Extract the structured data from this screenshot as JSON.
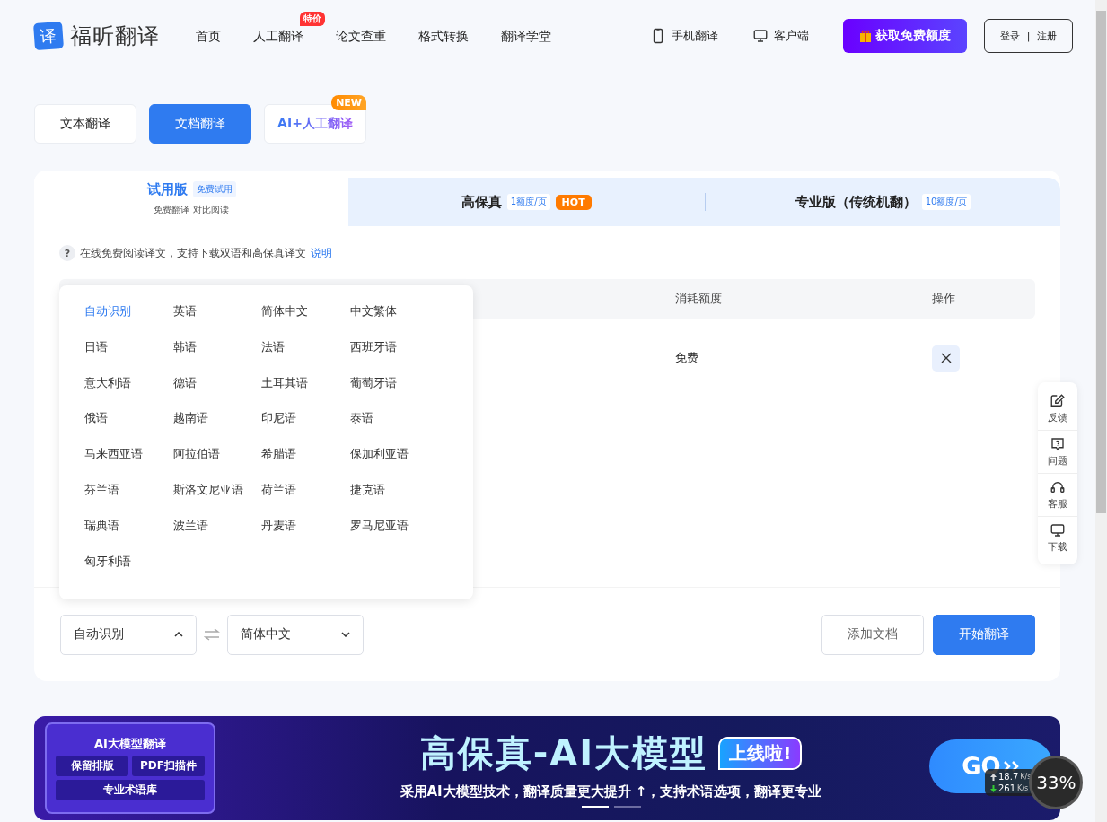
{
  "header": {
    "logo_mark": "译",
    "logo_text": "福昕翻译",
    "nav": [
      {
        "label": "首页"
      },
      {
        "label": "人工翻译",
        "badge": "特价"
      },
      {
        "label": "论文查重"
      },
      {
        "label": "格式转换"
      },
      {
        "label": "翻译学堂"
      }
    ],
    "links": [
      {
        "label": "手机翻译",
        "kind": "phone"
      },
      {
        "label": "客户端",
        "kind": "monitor"
      }
    ],
    "promo_button": "获取免费额度",
    "login": "登录",
    "separator": "|",
    "register": "注册"
  },
  "mode_tabs": [
    {
      "label": "文本翻译",
      "selected": false
    },
    {
      "label": "文档翻译",
      "selected": true
    },
    {
      "label": "AI+人工翻译",
      "selected": false,
      "badge": "NEW"
    }
  ],
  "plans": [
    {
      "title": "试用版",
      "tag": "免费试用",
      "subtitle": "免费翻译 对比阅读",
      "selected": true
    },
    {
      "title": "高保真",
      "tag": "1额度/页",
      "badge": "HOT",
      "selected": false
    },
    {
      "title": "专业版（传统机翻）",
      "tag": "10额度/页",
      "selected": false
    }
  ],
  "notice": {
    "icon": "?",
    "text": "在线免费阅读译文，支持下载双语和高保真译文",
    "link": "说明"
  },
  "table": {
    "columns": [
      "消耗额度",
      "操作"
    ],
    "rows": [
      {
        "cost": "免费"
      }
    ]
  },
  "language_menu": [
    {
      "label": "自动识别",
      "selected": true
    },
    {
      "label": "英语",
      "selected": false
    },
    {
      "label": "简体中文",
      "selected": false
    },
    {
      "label": "中文繁体",
      "selected": false
    },
    {
      "label": "日语",
      "selected": false
    },
    {
      "label": "韩语",
      "selected": false
    },
    {
      "label": "法语",
      "selected": false
    },
    {
      "label": "西班牙语",
      "selected": false
    },
    {
      "label": "意大利语",
      "selected": false
    },
    {
      "label": "德语",
      "selected": false
    },
    {
      "label": "土耳其语",
      "selected": false
    },
    {
      "label": "葡萄牙语",
      "selected": false
    },
    {
      "label": "俄语",
      "selected": false
    },
    {
      "label": "越南语",
      "selected": false
    },
    {
      "label": "印尼语",
      "selected": false
    },
    {
      "label": "泰语",
      "selected": false
    },
    {
      "label": "马来西亚语",
      "selected": false
    },
    {
      "label": "阿拉伯语",
      "selected": false
    },
    {
      "label": "希腊语",
      "selected": false
    },
    {
      "label": "保加利亚语",
      "selected": false
    },
    {
      "label": "芬兰语",
      "selected": false
    },
    {
      "label": "斯洛文尼亚语",
      "selected": false
    },
    {
      "label": "荷兰语",
      "selected": false
    },
    {
      "label": "捷克语",
      "selected": false
    },
    {
      "label": "瑞典语",
      "selected": false
    },
    {
      "label": "波兰语",
      "selected": false
    },
    {
      "label": "丹麦语",
      "selected": false
    },
    {
      "label": "罗马尼亚语",
      "selected": false
    },
    {
      "label": "匈牙利语",
      "selected": false
    }
  ],
  "source_language": {
    "value": "自动识别",
    "expanded": true
  },
  "target_language": {
    "value": "简体中文",
    "expanded": false
  },
  "actions": {
    "add": "添加文档",
    "start": "开始翻译"
  },
  "side_tools": [
    {
      "label": "反馈",
      "kind": "edit"
    },
    {
      "label": "问题",
      "kind": "question"
    },
    {
      "label": "客服",
      "kind": "support"
    },
    {
      "label": "下载",
      "kind": "monitor"
    }
  ],
  "banner": {
    "box_title": "AI大模型翻译",
    "features": [
      "保留排版",
      "PDF扫描件",
      "专业术语库"
    ],
    "headline": "高保真-AI大模型",
    "tag": "上线啦!",
    "subtitle": "采用AI大模型技术，翻译质量更大提升 ↑，支持术语选项，翻译更专业",
    "go": "GO",
    "dots": [
      {
        "selected": true
      },
      {
        "selected": false
      }
    ]
  },
  "net_widget": {
    "upload": "18.7",
    "upload_unit": "K/s",
    "download": "261",
    "download_unit": "K/s",
    "percent": "33",
    "percent_sign": "%"
  }
}
